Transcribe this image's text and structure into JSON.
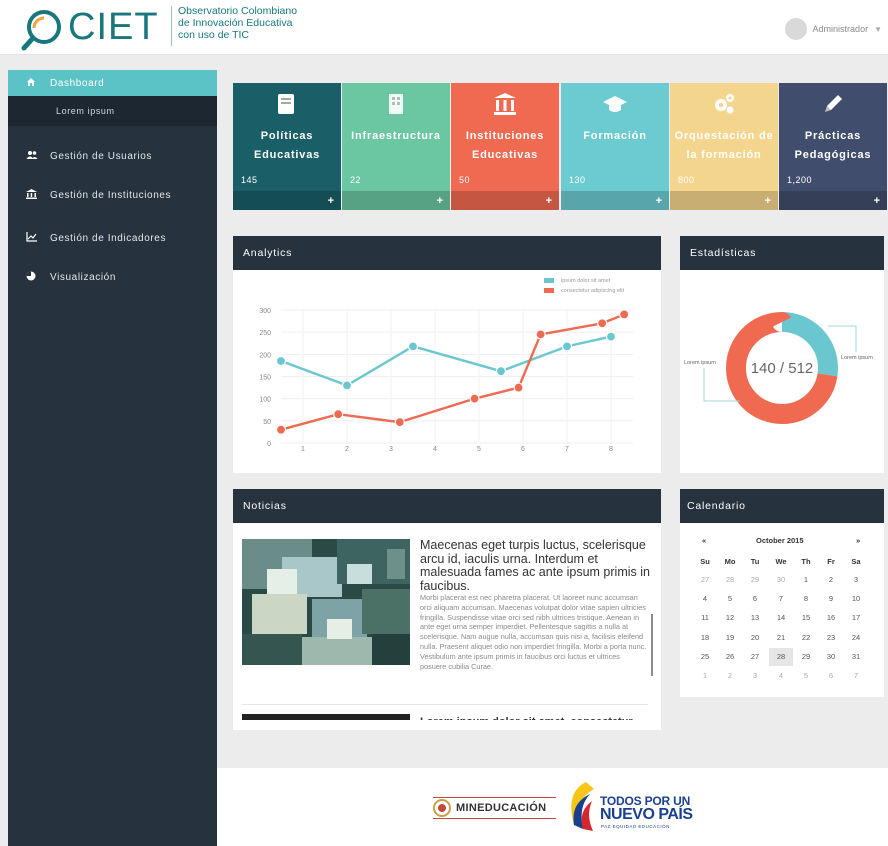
{
  "header": {
    "logo_text": "CIET",
    "logo_subtitle": "Observatorio Colombiano\nde Innovación Educativa\ncon uso de TIC",
    "user_name": "Administrador",
    "user_caret": "▼"
  },
  "sidebar": {
    "items": [
      {
        "label": "Dashboard",
        "icon": "home-icon",
        "glyph": "⌂"
      },
      {
        "label": "Lorem ipsum"
      },
      {
        "label": "Gestión de Usuarios",
        "icon": "users-icon",
        "glyph": "👥"
      },
      {
        "label": "Gestión de Instituciones",
        "icon": "institution-icon",
        "glyph": "🏛"
      },
      {
        "label": "Gestión de Indicadores",
        "icon": "line-chart-icon",
        "glyph": "📈"
      },
      {
        "label": "Visualización",
        "icon": "pie-chart-icon",
        "glyph": "◔"
      }
    ]
  },
  "tiles": [
    {
      "label": "Políticas Educativas",
      "count": "145",
      "color": "#1a5e68",
      "icon": "book-icon"
    },
    {
      "label": "Infraestructura",
      "count": "22",
      "color": "#6bc6a2",
      "icon": "building-icon"
    },
    {
      "label": "Instituciones Educativas",
      "count": "50",
      "color": "#ef6a51",
      "icon": "institution-icon"
    },
    {
      "label": "Formación",
      "count": "130",
      "color": "#6ccbd1",
      "icon": "graduation-cap-icon"
    },
    {
      "label": "Orquestación de la formación",
      "count": "800",
      "color": "#f4d58d",
      "icon": "gears-icon"
    },
    {
      "label": "Prácticas Pedagógicas",
      "count": "1,200",
      "color": "#414d6c",
      "icon": "pencil-icon"
    }
  ],
  "tile_plus": "+",
  "analytics": {
    "title": "Analytics",
    "chart_data": {
      "type": "line",
      "x": [
        0.5,
        2,
        3.5,
        4.5,
        5.5,
        6,
        7,
        8
      ],
      "series": [
        {
          "name": "ipsum dolor sit amet",
          "color": "#6ac7d0",
          "x": [
            0.5,
            2,
            3.5,
            5.5,
            7,
            8
          ],
          "values": [
            185,
            130,
            218,
            162,
            218,
            240
          ]
        },
        {
          "name": "consectetur adipiscing elit",
          "color": "#ef6a51",
          "x": [
            0.5,
            1.8,
            3.2,
            4.9,
            5.9,
            6.4,
            7.8,
            8.3
          ],
          "values": [
            30,
            65,
            47,
            100,
            125,
            245,
            270,
            290
          ]
        }
      ],
      "xticks": [
        "1",
        "2",
        "3",
        "4",
        "5",
        "6",
        "7",
        "8"
      ],
      "yticks": [
        "0",
        "50",
        "100",
        "150",
        "200",
        "250",
        "300"
      ],
      "xlim": [
        0.5,
        8.5
      ],
      "ylim": [
        0,
        300
      ],
      "grid": true,
      "legend": "top-right"
    }
  },
  "estadisticas": {
    "title": "Estadísticas",
    "center_text": "140 / 512",
    "chart_data": {
      "type": "pie",
      "categories": [
        "Lorem ipsum",
        "Lorem ipsum"
      ],
      "values": [
        140,
        372
      ],
      "colors": [
        "#6ac7d0",
        "#ef6a51"
      ]
    }
  },
  "noticias": {
    "title": "Noticias",
    "items": [
      {
        "title": "Maecenas eget turpis luctus, scelerisque arcu id, iaculis urna. Interdum et malesuada fames ac ante ipsum primis in faucibus.",
        "body": "Morbi placerat est nec pharetra placerat. Ut laoreet nunc accumsan orci aliquam accumsan. Maecenas volutpat dolor vitae sapien ultricies fringilla. Suspendisse vitae orci sed nibh ultrices tristique. Aenean in ante eget urna semper imperdiet. Pellentesque sagittis a nulla at scelerisque. Nam augue nulla, accumsan quis nisi a, facilisis eleifend nulla. Praesent aliquet odio non imperdiet fringilla. Morbi a porta nunc. Vestibulum ante ipsum primis in faucibus orci luctus et ultrices posuere cubilia Curae."
      },
      {
        "title": "Lorem ipsum dolor sit amet, consectetur"
      }
    ]
  },
  "calendario": {
    "title": "Calendario",
    "month": "October 2015",
    "prev": "«",
    "next": "»",
    "weekdays": [
      "Su",
      "Mo",
      "Tu",
      "We",
      "Th",
      "Fr",
      "Sa"
    ],
    "weeks": [
      [
        "27",
        "28",
        "29",
        "30",
        "1",
        "2",
        "3"
      ],
      [
        "4",
        "5",
        "6",
        "7",
        "8",
        "9",
        "10"
      ],
      [
        "11",
        "12",
        "13",
        "14",
        "15",
        "16",
        "17"
      ],
      [
        "18",
        "19",
        "20",
        "21",
        "22",
        "23",
        "24"
      ],
      [
        "25",
        "26",
        "27",
        "28",
        "29",
        "30",
        "31"
      ],
      [
        "1",
        "2",
        "3",
        "4",
        "5",
        "6",
        "7"
      ]
    ],
    "selected": "28"
  },
  "footer": {
    "ministry": "MINEDUCACIÓN",
    "slogan_line1": "TODOS POR UN",
    "slogan_line2": "NUEVO PAÍS",
    "slogan_line3": "PAZ  EQUIDAD  EDUCACIÓN"
  }
}
